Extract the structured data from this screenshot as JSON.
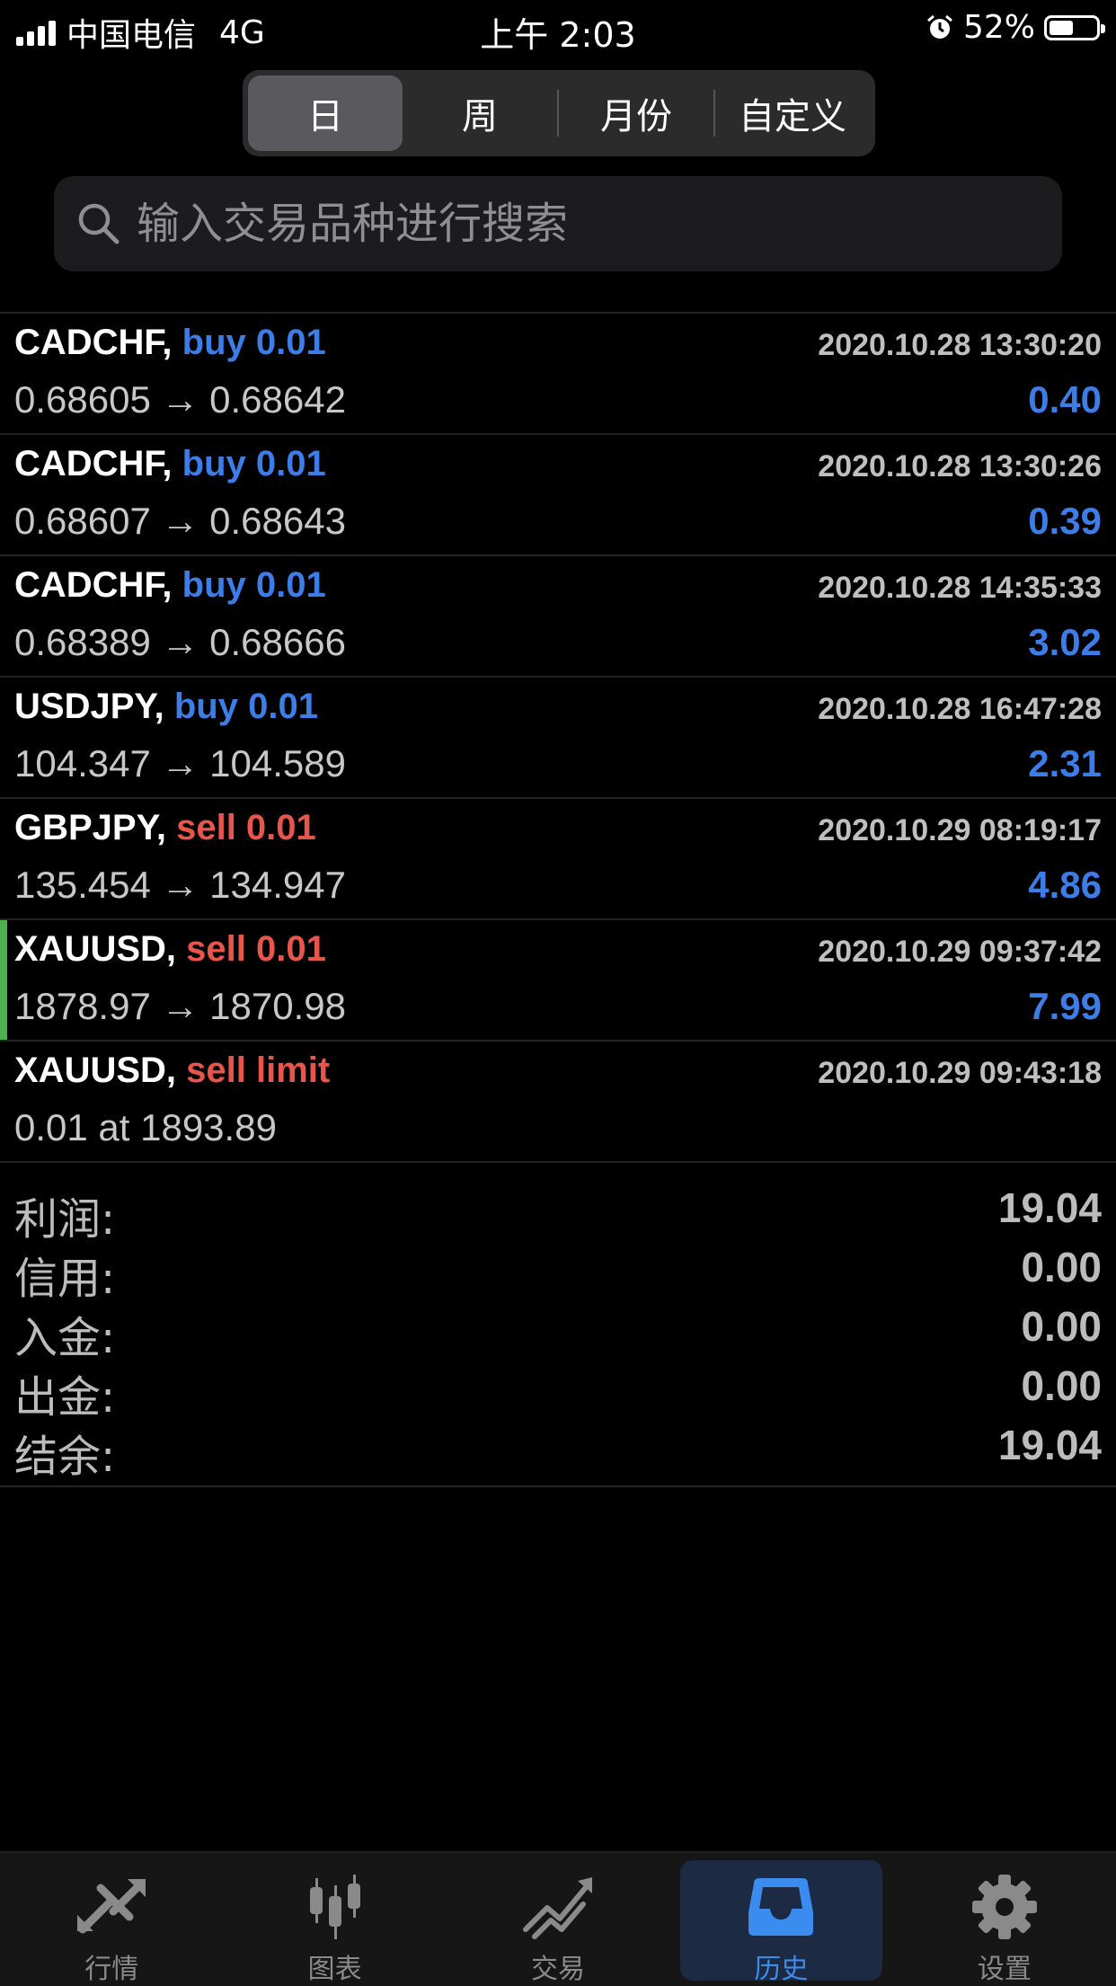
{
  "status_bar": {
    "carrier": "中国电信",
    "network": "4G",
    "time": "上午 2:03",
    "battery": "52%"
  },
  "segments": [
    {
      "label": "日",
      "active": true
    },
    {
      "label": "周",
      "active": false
    },
    {
      "label": "月份",
      "active": false
    },
    {
      "label": "自定义",
      "active": false
    }
  ],
  "search": {
    "placeholder": "输入交易品种进行搜索"
  },
  "trades": [
    {
      "symbol": "CADCHF,",
      "action": "buy 0.01",
      "type": "buy",
      "time": "2020.10.28 13:30:20",
      "prices": "0.68605 → 0.68642",
      "profit": "0.40"
    },
    {
      "symbol": "CADCHF,",
      "action": "buy 0.01",
      "type": "buy",
      "time": "2020.10.28 13:30:26",
      "prices": "0.68607 → 0.68643",
      "profit": "0.39"
    },
    {
      "symbol": "CADCHF,",
      "action": "buy 0.01",
      "type": "buy",
      "time": "2020.10.28 14:35:33",
      "prices": "0.68389 → 0.68666",
      "profit": "3.02"
    },
    {
      "symbol": "USDJPY,",
      "action": "buy 0.01",
      "type": "buy",
      "time": "2020.10.28 16:47:28",
      "prices": "104.347 → 104.589",
      "profit": "2.31"
    },
    {
      "symbol": "GBPJPY,",
      "action": "sell 0.01",
      "type": "sell",
      "time": "2020.10.29 08:19:17",
      "prices": "135.454 → 134.947",
      "profit": "4.86"
    },
    {
      "symbol": "XAUUSD,",
      "action": "sell 0.01",
      "type": "sell",
      "time": "2020.10.29 09:37:42",
      "prices": "1878.97 → 1870.98",
      "profit": "7.99",
      "highlight": true
    },
    {
      "symbol": "XAUUSD,",
      "action": "sell limit",
      "type": "sell",
      "time": "2020.10.29 09:43:18",
      "prices": "0.01 at 1893.89",
      "profit": ""
    }
  ],
  "summary": [
    {
      "label": "利润:",
      "value": "19.04"
    },
    {
      "label": "信用:",
      "value": "0.00"
    },
    {
      "label": "入金:",
      "value": "0.00"
    },
    {
      "label": "出金:",
      "value": "0.00"
    },
    {
      "label": "结余:",
      "value": "19.04"
    }
  ],
  "tabs": [
    {
      "label": "行情",
      "icon": "quotes-arrows-icon",
      "active": false
    },
    {
      "label": "图表",
      "icon": "candlestick-chart-icon",
      "active": false
    },
    {
      "label": "交易",
      "icon": "trade-trend-icon",
      "active": false
    },
    {
      "label": "历史",
      "icon": "history-inbox-icon",
      "active": true
    },
    {
      "label": "设置",
      "icon": "gear-icon",
      "active": false
    }
  ],
  "colors": {
    "buy": "#3c7de8",
    "sell": "#e8554b",
    "profit": "#3c7de8",
    "highlight_bar": "#4caf50",
    "tab_active": "#3c8cf0"
  }
}
